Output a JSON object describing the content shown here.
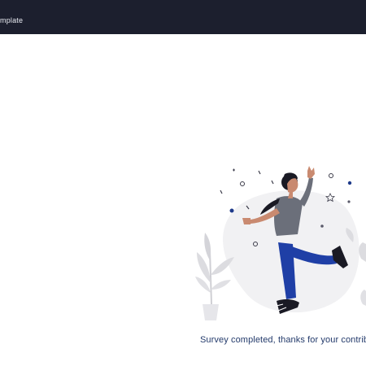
{
  "header": {
    "title": "mplate"
  },
  "illustration": {
    "name": "celebration-illustration"
  },
  "status": {
    "message": "Survey completed, thanks for your contributi"
  },
  "colors": {
    "header_bg": "#1c1f2e",
    "message_text": "#233a6b",
    "accent_blue": "#1f3fa6",
    "dot_navy": "#1e3a8a"
  }
}
